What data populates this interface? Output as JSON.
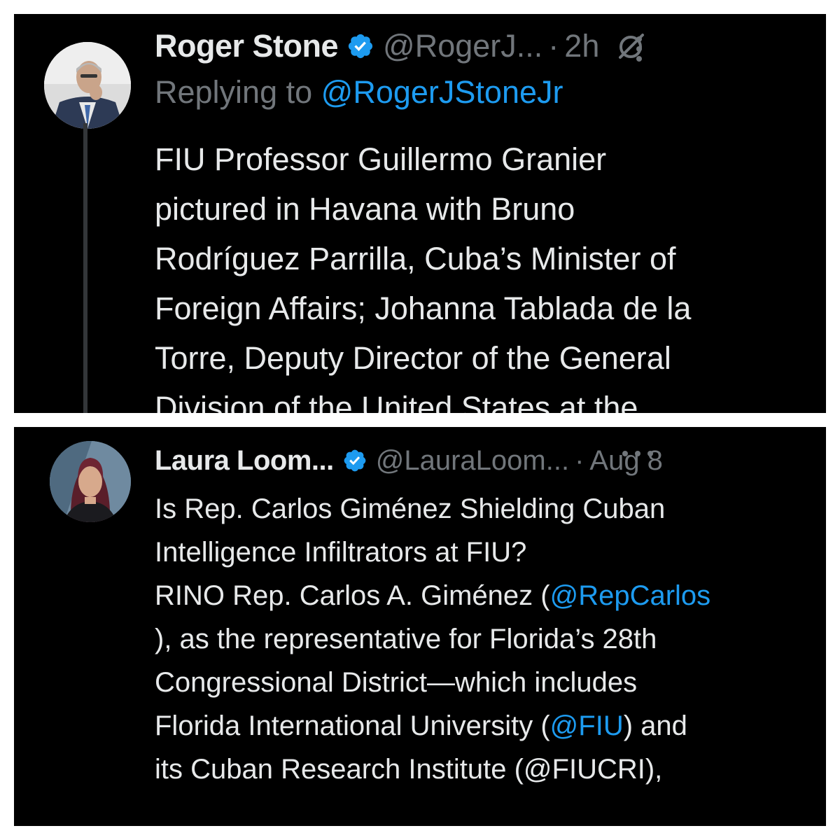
{
  "tweets": [
    {
      "name": "Roger Stone",
      "handle": "@RogerJ...",
      "separator": "·",
      "time": "2h",
      "replying_prefix": "Replying to",
      "replying_handle": "@RogerJStoneJr",
      "lines": [
        "FIU Professor Guillermo Granier",
        "pictured in Havana with Bruno",
        "Rodríguez Parrilla, Cuba’s Minister of",
        "Foreign Affairs; Johanna Tablada de la",
        "Torre, Deputy Director of the General",
        "Division of the United States at the"
      ]
    },
    {
      "name": "Laura Loom...",
      "handle": "@LauraLoom...",
      "separator": "·",
      "time": "Aug 8",
      "line1": "Is Rep. Carlos Giménez Shielding Cuban",
      "line2": "Intelligence Infiltrators at FIU?",
      "line3_prefix": "RINO Rep. Carlos A. Giménez (",
      "line3_mention": "@RepCarlos",
      "line4": "), as the representative for Florida’s 28th",
      "line5": "Congressional District—which includes",
      "line6_prefix": "Florida International University (",
      "line6_mention": "@FIU",
      "line6_suffix": ") and",
      "line7": "its Cuban Research Institute (@FIUCRI),"
    }
  ],
  "colors": {
    "background": "#000000",
    "text": "#e7e9ea",
    "muted": "#71767b",
    "link": "#1d9bf0",
    "verified": "#1d9bf0"
  },
  "icons": [
    "verified-badge-icon",
    "grok-icon",
    "more-options-icon"
  ]
}
